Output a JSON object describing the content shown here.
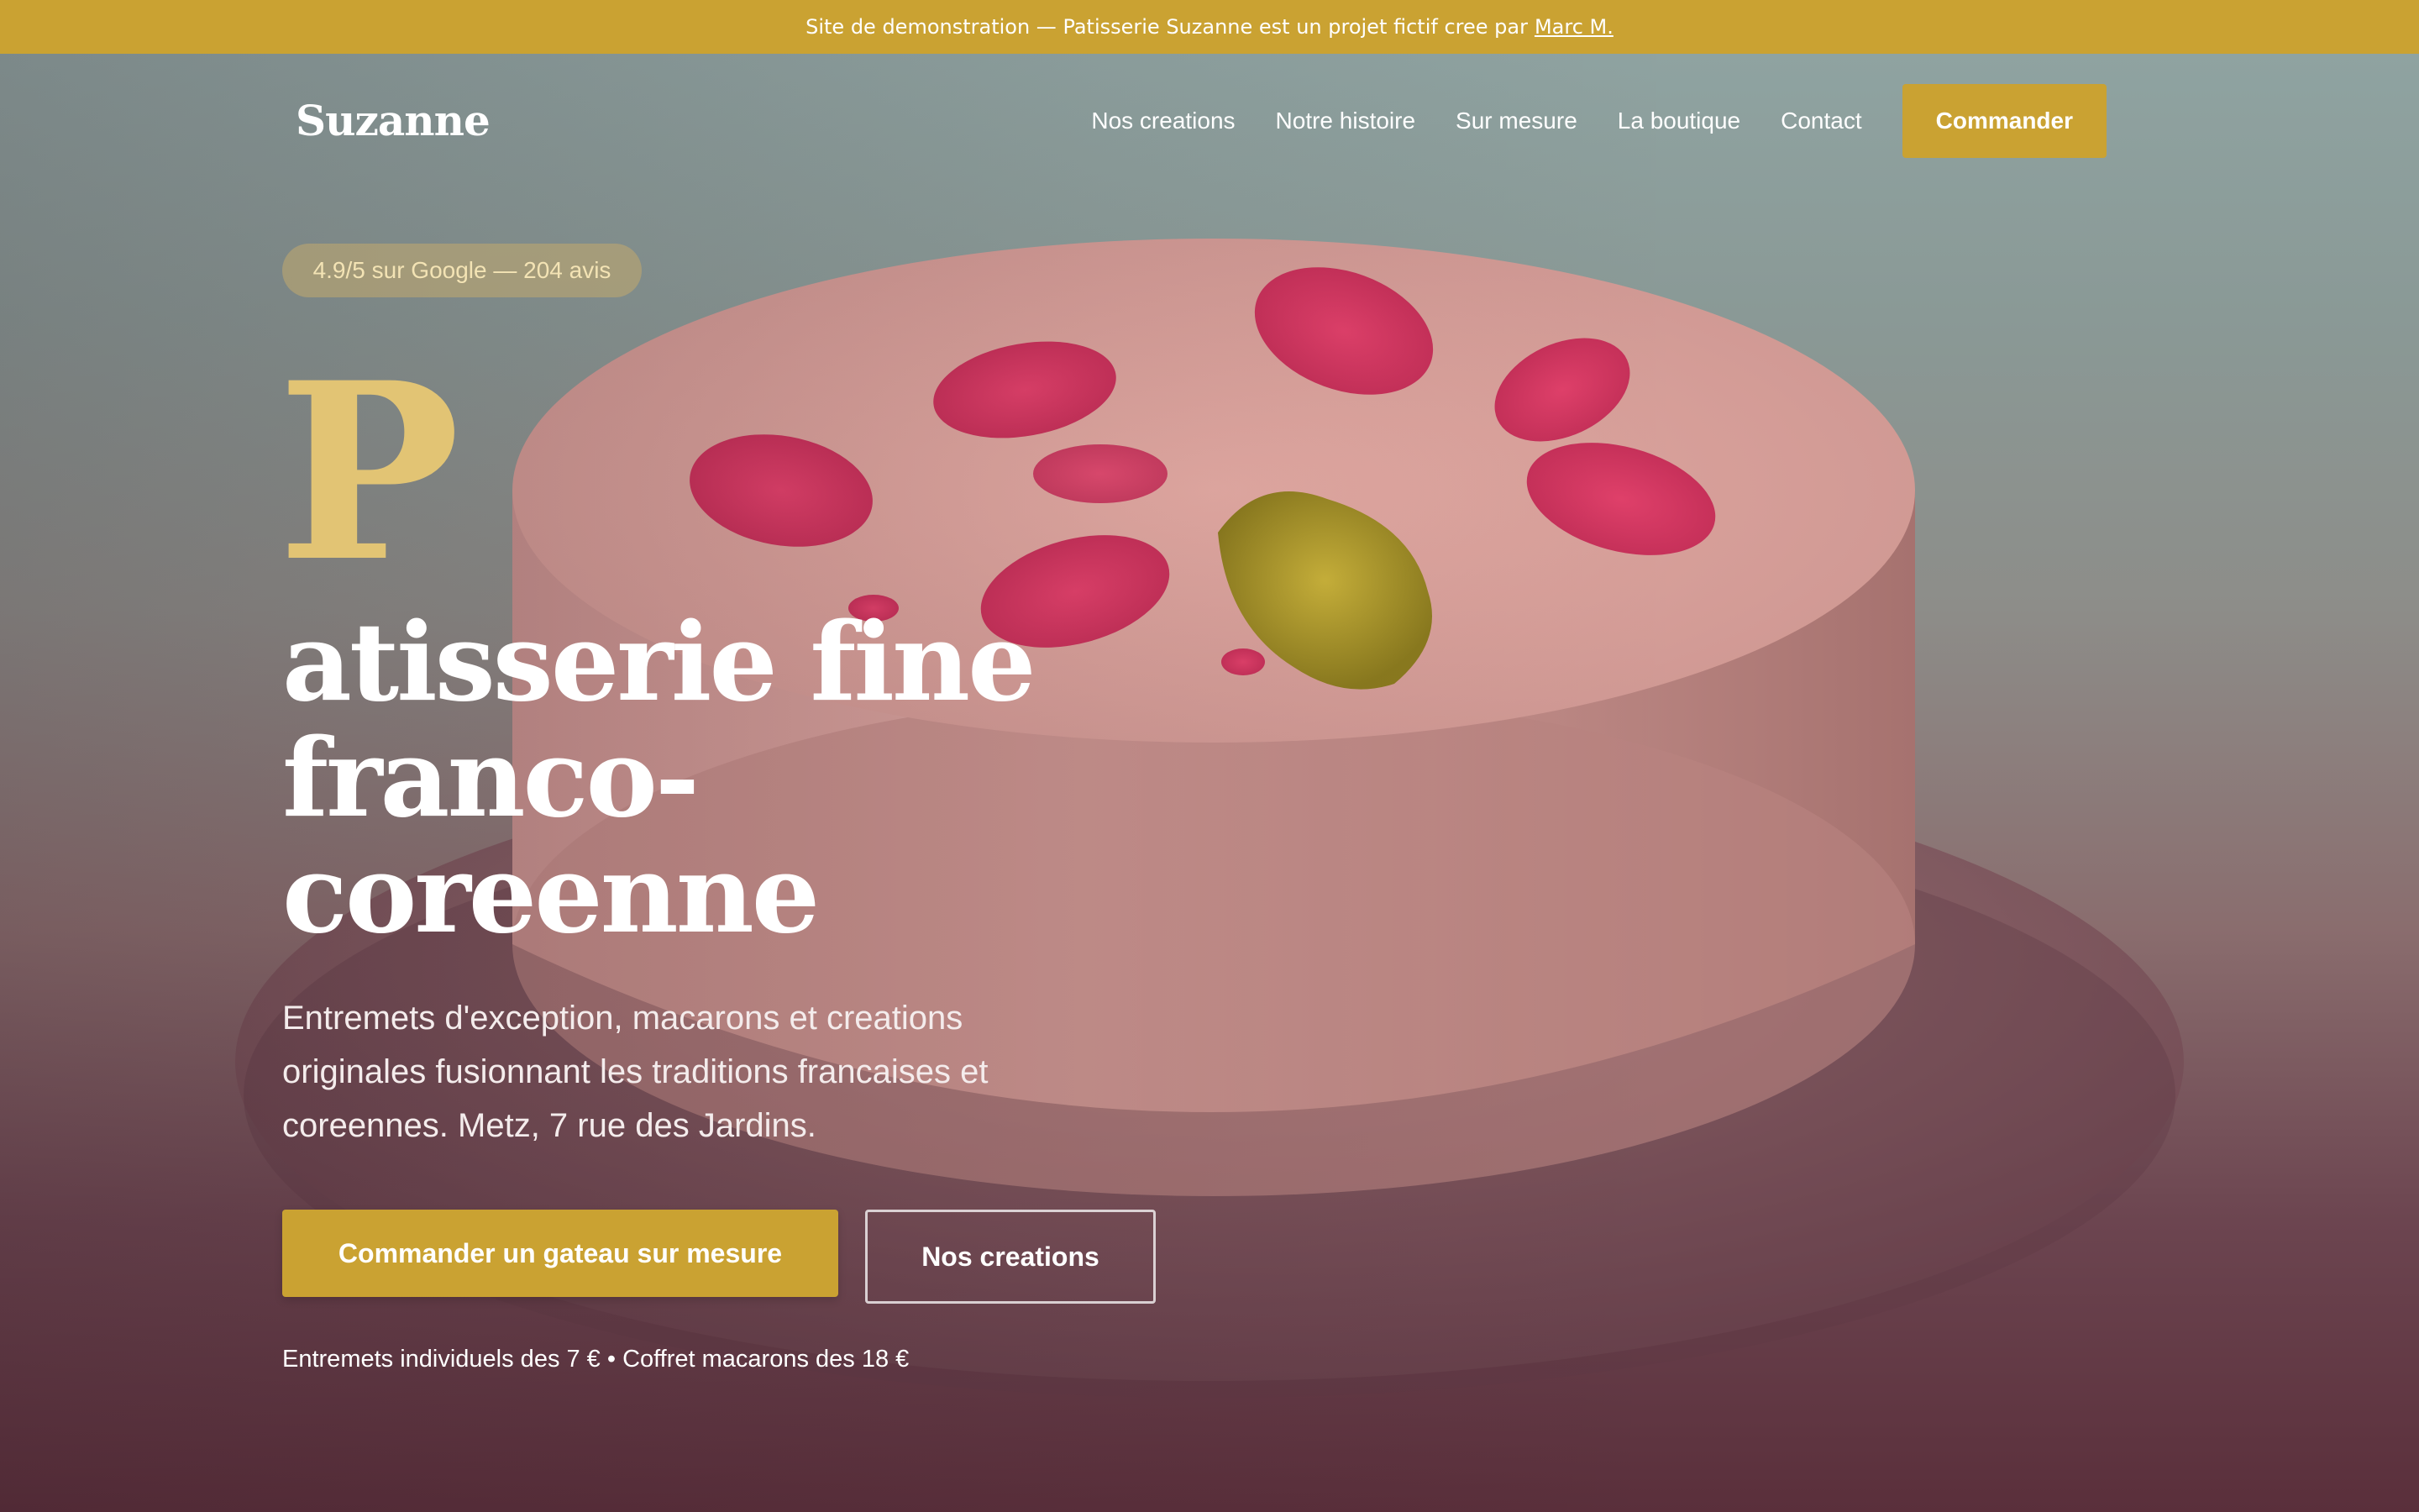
{
  "banner": {
    "text": "Site de demonstration — Patisserie Suzanne est un projet fictif cree par",
    "author_link": "Marc M."
  },
  "nav": {
    "brand": "Suzanne",
    "links": [
      "Nos creations",
      "Notre histoire",
      "Sur mesure",
      "La boutique",
      "Contact"
    ],
    "cta": "Commander"
  },
  "hero": {
    "rating": "4.9/5 sur Google — 204 avis",
    "drop_cap": "P",
    "title": "atisserie fine franco-coreenne",
    "description": "Entremets d'exception, macarons et creations originales fusionnant les traditions francaises et coreennes. Metz, 7 rue des Jardins.",
    "primary_button": "Commander un gateau sur mesure",
    "secondary_button": "Nos creations",
    "price_note": "Entremets individuels des 7 € • Coffret macarons des 18 €"
  },
  "colors": {
    "accent": "#caa232",
    "drop_cap": "#e2c474",
    "text": "#ffffff"
  }
}
